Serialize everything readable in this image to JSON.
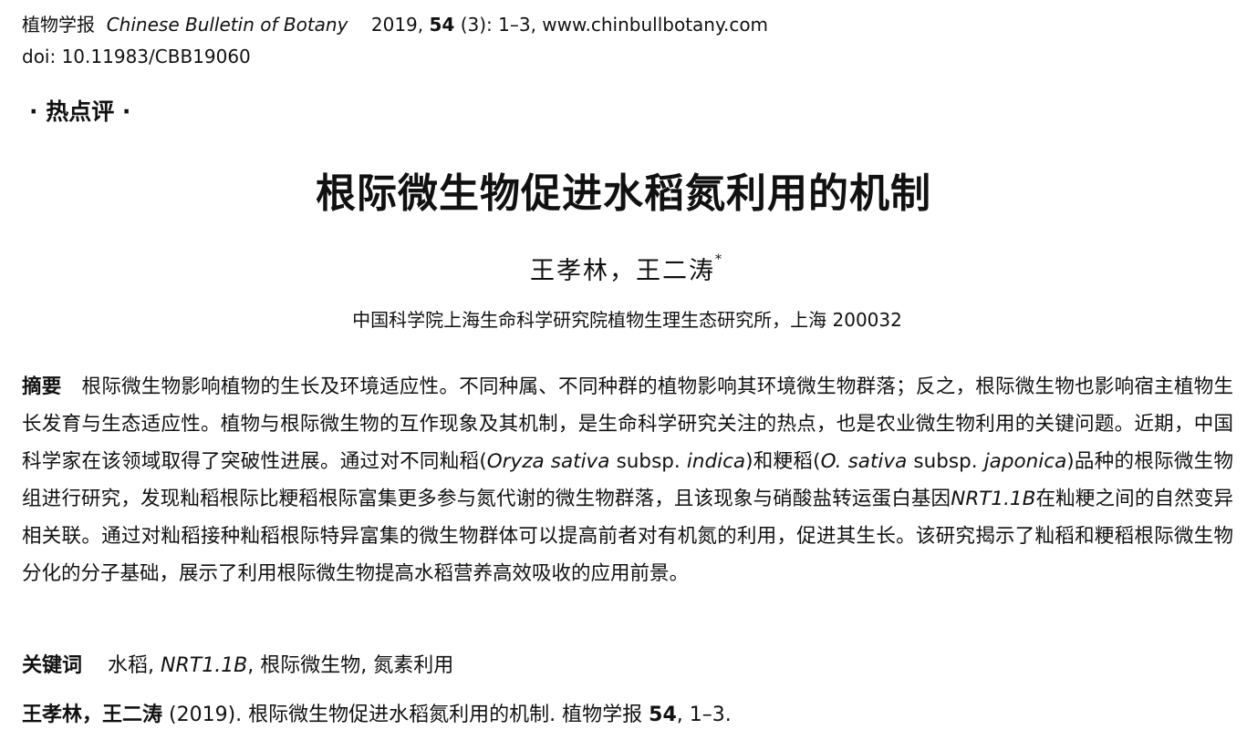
{
  "header": {
    "journal_cn": "植物学报",
    "journal_en": "Chinese Bulletin of Botany",
    "year_prefix": "2019,",
    "volume": "54",
    "issue_pages": "(3): 1–3, www.chinbullbotany.com",
    "doi": "doi: 10.11983/CBB19060"
  },
  "section_tag": "· 热点评 ·",
  "title": "根际微生物促进水稻氮利用的机制",
  "authors": {
    "names": "王孝林，王二涛",
    "mark": "*"
  },
  "affiliation": "中国科学院上海生命科学研究院植物生理生态研究所，上海  200032",
  "abstract": {
    "label": "摘要",
    "p1": "根际微生物影响植物的生长及环境适应性。不同种属、不同种群的植物影响其环境微生物群落；反之，根际微生物也影响宿主植物生长发育与生态适应性。植物与根际微生物的互作现象及其机制，是生命科学研究关注的热点，也是农业微生物利用的关键问题。近期，中国科学家在该领域取得了突破性进展。通过对不同籼稻(",
    "sp1_genus": "Oryza sativa",
    "subsp_word": " subsp. ",
    "sp1_sub": "indica",
    "p2": ")和粳稻(",
    "sp2_genus": "O. sativa",
    "sp2_sub": "japonica",
    "p3": ")品种的根际微生物组进行研究，发现籼稻根际比粳稻根际富集更多参与氮代谢的微生物群落，且该现象与硝酸盐转运蛋白基因",
    "gene": "NRT1.1B",
    "p4": "在籼粳之间的自然变异相关联。通过对籼稻接种籼稻根际特异富集的微生物群体可以提高前者对有机氮的利用，促进其生长。该研究揭示了籼稻和粳稻根际微生物分化的分子基础，展示了利用根际微生物提高水稻营养高效吸收的应用前景。"
  },
  "keywords": {
    "label": "关键词",
    "k1": "水稻,",
    "k2": "NRT1.1B",
    "k3": ",  根际微生物,  氮素利用"
  },
  "citation": {
    "authors": "王孝林，王二涛",
    "rest1": " (2019).  根际微生物促进水稻氮利用的机制.  植物学报  ",
    "volume": "54",
    "rest2": ", 1–3."
  }
}
